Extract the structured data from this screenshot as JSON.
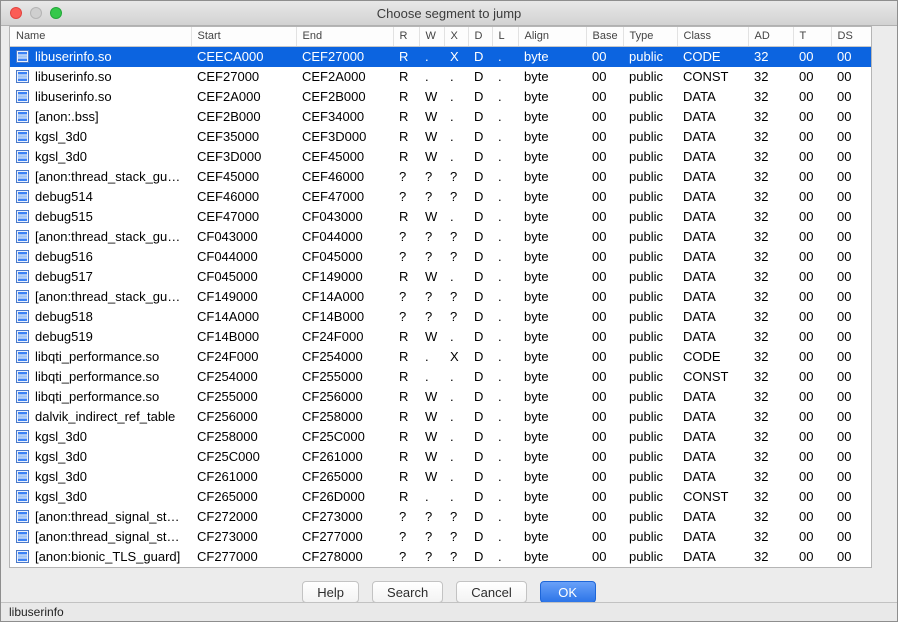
{
  "window": {
    "title": "Choose segment to jump"
  },
  "table": {
    "columns": [
      "Name",
      "Start",
      "End",
      "R",
      "W",
      "X",
      "D",
      "L",
      "Align",
      "Base",
      "Type",
      "Class",
      "AD",
      "T",
      "DS"
    ],
    "selected_row": 0,
    "rows": [
      [
        "libuserinfo.so",
        "CEECA000",
        "CEF27000",
        "R",
        ".",
        "X",
        "D",
        ".",
        "byte",
        "00",
        "public",
        "CODE",
        "32",
        "00",
        "00"
      ],
      [
        "libuserinfo.so",
        "CEF27000",
        "CEF2A000",
        "R",
        ".",
        ".",
        "D",
        ".",
        "byte",
        "00",
        "public",
        "CONST",
        "32",
        "00",
        "00"
      ],
      [
        "libuserinfo.so",
        "CEF2A000",
        "CEF2B000",
        "R",
        "W",
        ".",
        "D",
        ".",
        "byte",
        "00",
        "public",
        "DATA",
        "32",
        "00",
        "00"
      ],
      [
        "[anon:.bss]",
        "CEF2B000",
        "CEF34000",
        "R",
        "W",
        ".",
        "D",
        ".",
        "byte",
        "00",
        "public",
        "DATA",
        "32",
        "00",
        "00"
      ],
      [
        "kgsl_3d0",
        "CEF35000",
        "CEF3D000",
        "R",
        "W",
        ".",
        "D",
        ".",
        "byte",
        "00",
        "public",
        "DATA",
        "32",
        "00",
        "00"
      ],
      [
        "kgsl_3d0",
        "CEF3D000",
        "CEF45000",
        "R",
        "W",
        ".",
        "D",
        ".",
        "byte",
        "00",
        "public",
        "DATA",
        "32",
        "00",
        "00"
      ],
      [
        "[anon:thread_stack_gu…",
        "CEF45000",
        "CEF46000",
        "?",
        "?",
        "?",
        "D",
        ".",
        "byte",
        "00",
        "public",
        "DATA",
        "32",
        "00",
        "00"
      ],
      [
        "debug514",
        "CEF46000",
        "CEF47000",
        "?",
        "?",
        "?",
        "D",
        ".",
        "byte",
        "00",
        "public",
        "DATA",
        "32",
        "00",
        "00"
      ],
      [
        "debug515",
        "CEF47000",
        "CF043000",
        "R",
        "W",
        ".",
        "D",
        ".",
        "byte",
        "00",
        "public",
        "DATA",
        "32",
        "00",
        "00"
      ],
      [
        "[anon:thread_stack_gu…",
        "CF043000",
        "CF044000",
        "?",
        "?",
        "?",
        "D",
        ".",
        "byte",
        "00",
        "public",
        "DATA",
        "32",
        "00",
        "00"
      ],
      [
        "debug516",
        "CF044000",
        "CF045000",
        "?",
        "?",
        "?",
        "D",
        ".",
        "byte",
        "00",
        "public",
        "DATA",
        "32",
        "00",
        "00"
      ],
      [
        "debug517",
        "CF045000",
        "CF149000",
        "R",
        "W",
        ".",
        "D",
        ".",
        "byte",
        "00",
        "public",
        "DATA",
        "32",
        "00",
        "00"
      ],
      [
        "[anon:thread_stack_gu…",
        "CF149000",
        "CF14A000",
        "?",
        "?",
        "?",
        "D",
        ".",
        "byte",
        "00",
        "public",
        "DATA",
        "32",
        "00",
        "00"
      ],
      [
        "debug518",
        "CF14A000",
        "CF14B000",
        "?",
        "?",
        "?",
        "D",
        ".",
        "byte",
        "00",
        "public",
        "DATA",
        "32",
        "00",
        "00"
      ],
      [
        "debug519",
        "CF14B000",
        "CF24F000",
        "R",
        "W",
        ".",
        "D",
        ".",
        "byte",
        "00",
        "public",
        "DATA",
        "32",
        "00",
        "00"
      ],
      [
        "libqti_performance.so",
        "CF24F000",
        "CF254000",
        "R",
        ".",
        "X",
        "D",
        ".",
        "byte",
        "00",
        "public",
        "CODE",
        "32",
        "00",
        "00"
      ],
      [
        "libqti_performance.so",
        "CF254000",
        "CF255000",
        "R",
        ".",
        ".",
        "D",
        ".",
        "byte",
        "00",
        "public",
        "CONST",
        "32",
        "00",
        "00"
      ],
      [
        "libqti_performance.so",
        "CF255000",
        "CF256000",
        "R",
        "W",
        ".",
        "D",
        ".",
        "byte",
        "00",
        "public",
        "DATA",
        "32",
        "00",
        "00"
      ],
      [
        "dalvik_indirect_ref_table",
        "CF256000",
        "CF258000",
        "R",
        "W",
        ".",
        "D",
        ".",
        "byte",
        "00",
        "public",
        "DATA",
        "32",
        "00",
        "00"
      ],
      [
        "kgsl_3d0",
        "CF258000",
        "CF25C000",
        "R",
        "W",
        ".",
        "D",
        ".",
        "byte",
        "00",
        "public",
        "DATA",
        "32",
        "00",
        "00"
      ],
      [
        "kgsl_3d0",
        "CF25C000",
        "CF261000",
        "R",
        "W",
        ".",
        "D",
        ".",
        "byte",
        "00",
        "public",
        "DATA",
        "32",
        "00",
        "00"
      ],
      [
        "kgsl_3d0",
        "CF261000",
        "CF265000",
        "R",
        "W",
        ".",
        "D",
        ".",
        "byte",
        "00",
        "public",
        "DATA",
        "32",
        "00",
        "00"
      ],
      [
        "kgsl_3d0",
        "CF265000",
        "CF26D000",
        "R",
        ".",
        ".",
        "D",
        ".",
        "byte",
        "00",
        "public",
        "CONST",
        "32",
        "00",
        "00"
      ],
      [
        "[anon:thread_signal_sta…",
        "CF272000",
        "CF273000",
        "?",
        "?",
        "?",
        "D",
        ".",
        "byte",
        "00",
        "public",
        "DATA",
        "32",
        "00",
        "00"
      ],
      [
        "[anon:thread_signal_sta…",
        "CF273000",
        "CF277000",
        "?",
        "?",
        "?",
        "D",
        ".",
        "byte",
        "00",
        "public",
        "DATA",
        "32",
        "00",
        "00"
      ],
      [
        "[anon:bionic_TLS_guard]",
        "CF277000",
        "CF278000",
        "?",
        "?",
        "?",
        "D",
        ".",
        "byte",
        "00",
        "public",
        "DATA",
        "32",
        "00",
        "00"
      ]
    ]
  },
  "buttons": {
    "help": "Help",
    "search": "Search",
    "cancel": "Cancel",
    "ok": "OK"
  },
  "status_bar": "libuserinfo",
  "colors": {
    "selection_bg": "#0c64e0",
    "selection_text": "#ffffff",
    "ok_button": "#2f7cf6",
    "close_light": "#fb5d56",
    "minimize_light": "#cfcfcf",
    "zoom_light": "#34c84a"
  }
}
